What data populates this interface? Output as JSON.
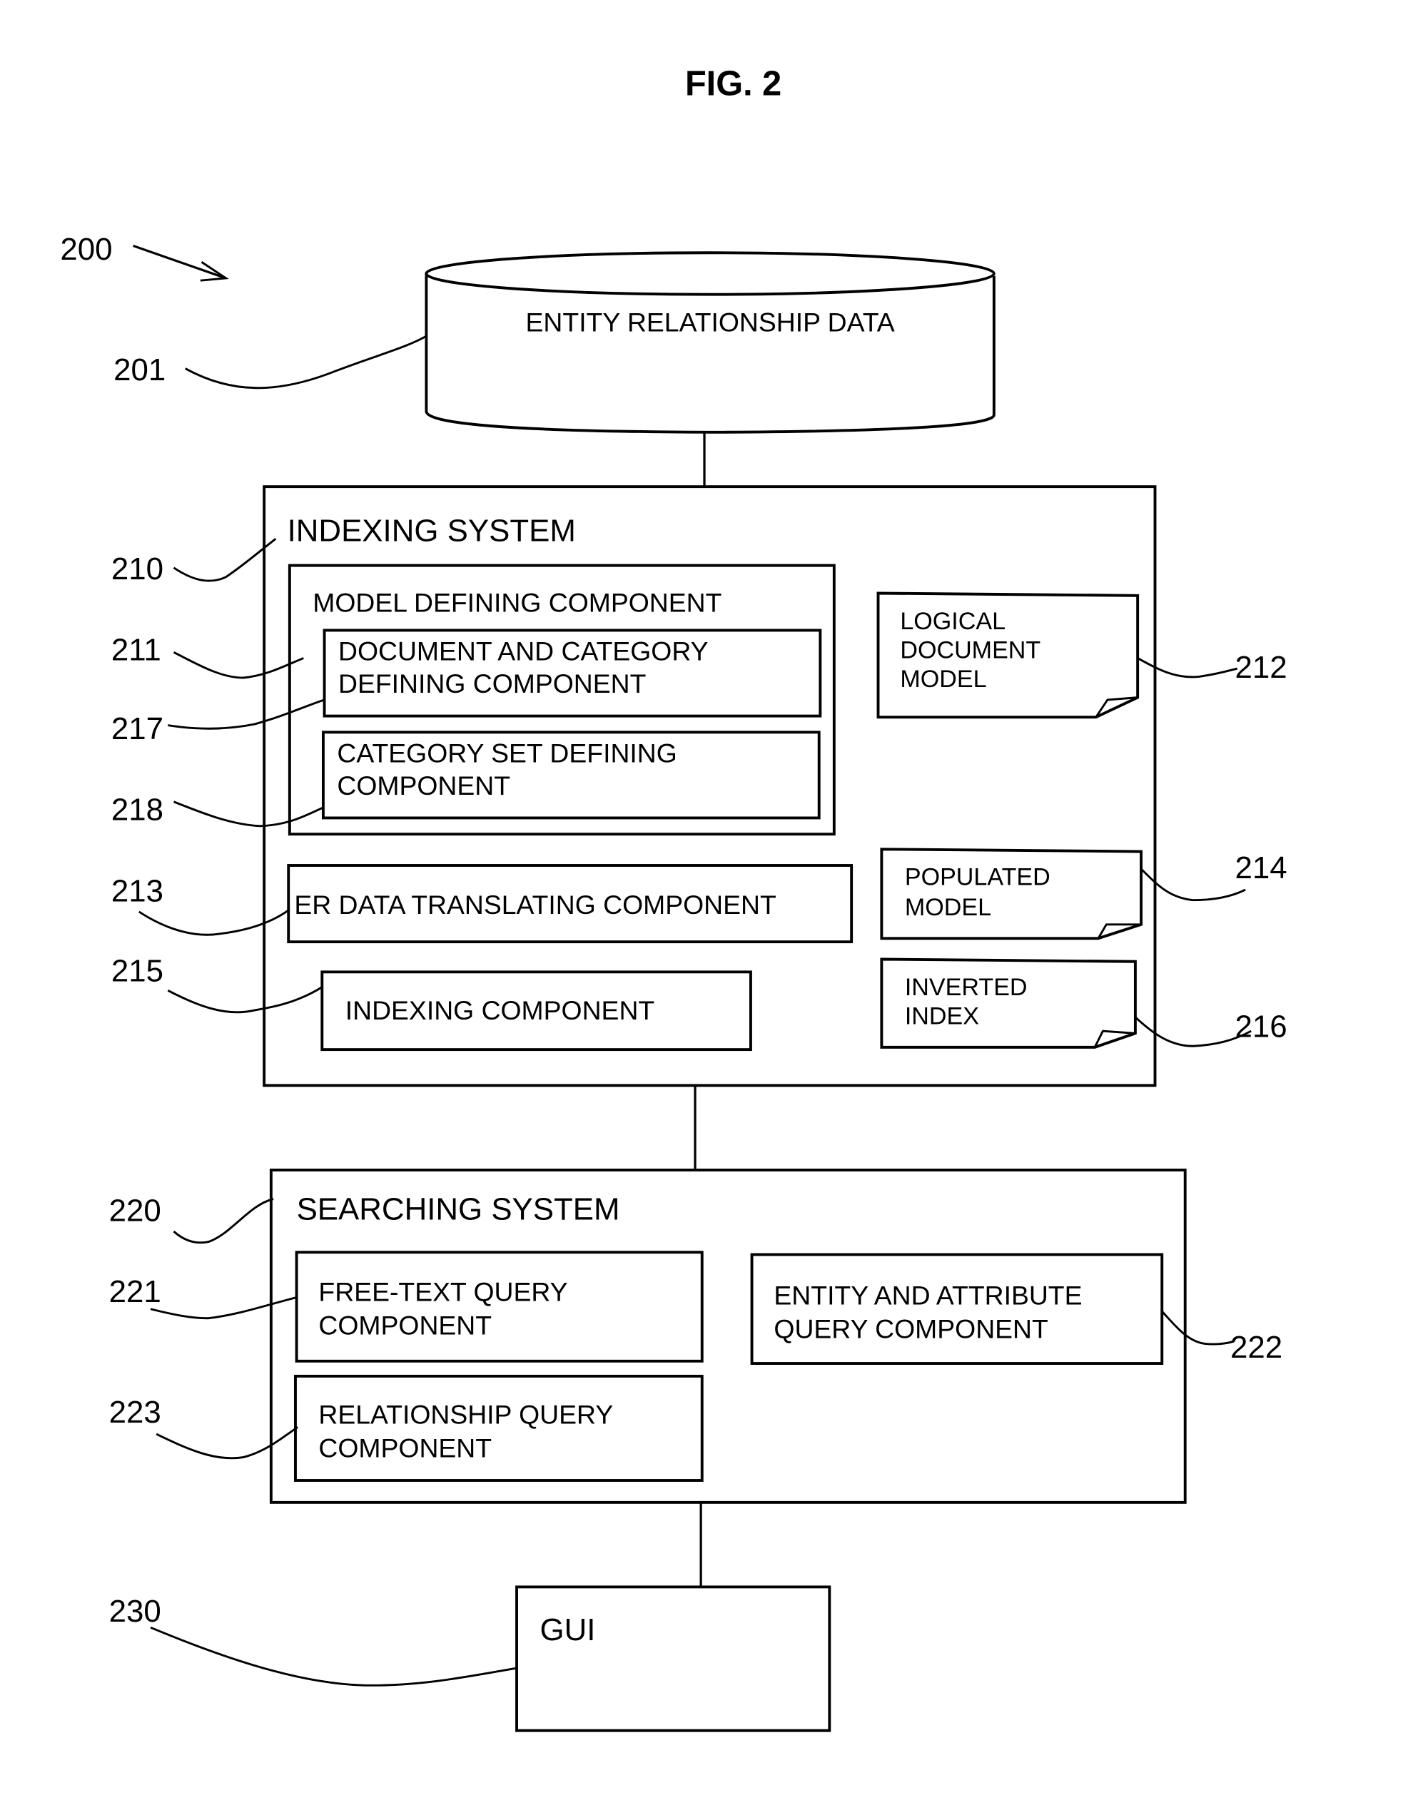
{
  "figure": {
    "title": "FIG. 2",
    "system_ref": "200"
  },
  "database": {
    "ref": "201",
    "label": "ENTITY RELATIONSHIP DATA"
  },
  "indexing_system": {
    "ref": "210",
    "label": "INDEXING SYSTEM",
    "model_defining": {
      "ref": "211",
      "label": "MODEL DEFINING COMPONENT",
      "doc_category": {
        "ref": "217",
        "lines": [
          "DOCUMENT AND CATEGORY",
          "DEFINING COMPONENT"
        ]
      },
      "category_set": {
        "ref": "218",
        "lines": [
          "CATEGORY SET DEFINING",
          "COMPONENT"
        ]
      }
    },
    "logical_model": {
      "ref": "212",
      "lines": [
        "LOGICAL",
        "DOCUMENT",
        "MODEL"
      ]
    },
    "er_translating": {
      "ref": "213",
      "label": "ER DATA TRANSLATING COMPONENT"
    },
    "populated_model": {
      "ref": "214",
      "lines": [
        "POPULATED",
        "MODEL"
      ]
    },
    "indexing_component": {
      "ref": "215",
      "label": "INDEXING COMPONENT"
    },
    "inverted_index": {
      "ref": "216",
      "lines": [
        "INVERTED",
        "INDEX"
      ]
    }
  },
  "searching_system": {
    "ref": "220",
    "label": "SEARCHING SYSTEM",
    "free_text": {
      "ref": "221",
      "lines": [
        "FREE-TEXT QUERY",
        "COMPONENT"
      ]
    },
    "entity_attribute": {
      "ref": "222",
      "lines": [
        "ENTITY AND ATTRIBUTE",
        "QUERY COMPONENT"
      ]
    },
    "relationship": {
      "ref": "223",
      "lines": [
        "RELATIONSHIP QUERY",
        "COMPONENT"
      ]
    }
  },
  "gui": {
    "ref": "230",
    "label": "GUI"
  }
}
